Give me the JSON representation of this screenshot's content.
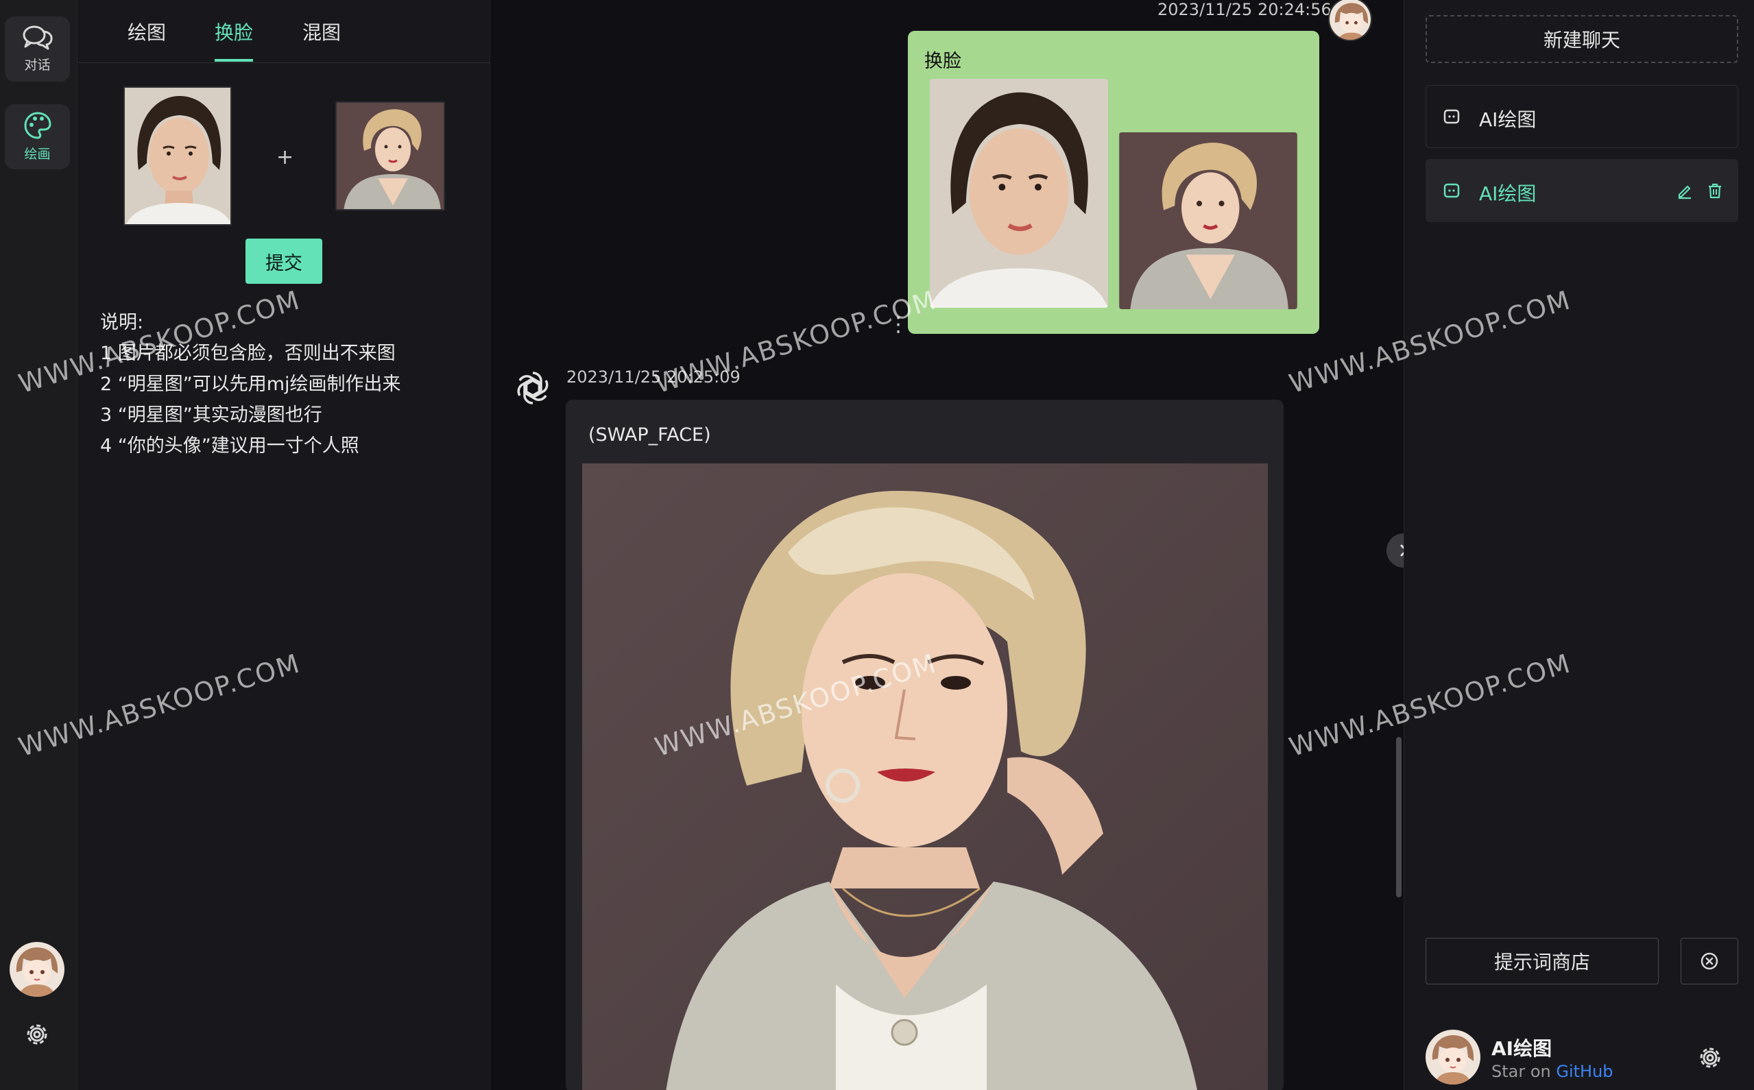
{
  "rail": {
    "chat_label": "对话",
    "draw_label": "绘画"
  },
  "draw_panel": {
    "tabs": [
      "绘图",
      "换脸",
      "混图"
    ],
    "active_tab": "换脸",
    "plus": "+",
    "submit_label": "提交",
    "notes": [
      "说明:",
      "1 图片都必须包含脸，否则出不来图",
      "2 “明星图”可以先用mj绘画制作出来",
      "3 “明星图”其实动漫图也行",
      "4 “你的头像”建议用一寸个人照"
    ]
  },
  "chat": {
    "user_msg": {
      "timestamp": "2023/11/25 20:24:56",
      "text": "换脸"
    },
    "bot_msg": {
      "timestamp": "2023/11/25 20:25:09",
      "text": "(SWAP_FACE)"
    },
    "more_icon": "⋮"
  },
  "sidebar": {
    "new_chat_label": "新建聊天",
    "conversations": [
      {
        "label": "AI绘图",
        "active": false
      },
      {
        "label": "AI绘图",
        "active": true
      }
    ],
    "prompt_store_label": "提示词商店",
    "profile": {
      "name": "AI绘图",
      "sub_prefix": "Star on ",
      "sub_link": "GitHub"
    }
  },
  "watermark": "WWW.ABSKOOP.COM",
  "colors": {
    "accent": "#63e2b7",
    "user_bubble": "#a6d88f",
    "background": "#101014",
    "panel": "#18181c",
    "link": "#3b82f6"
  }
}
